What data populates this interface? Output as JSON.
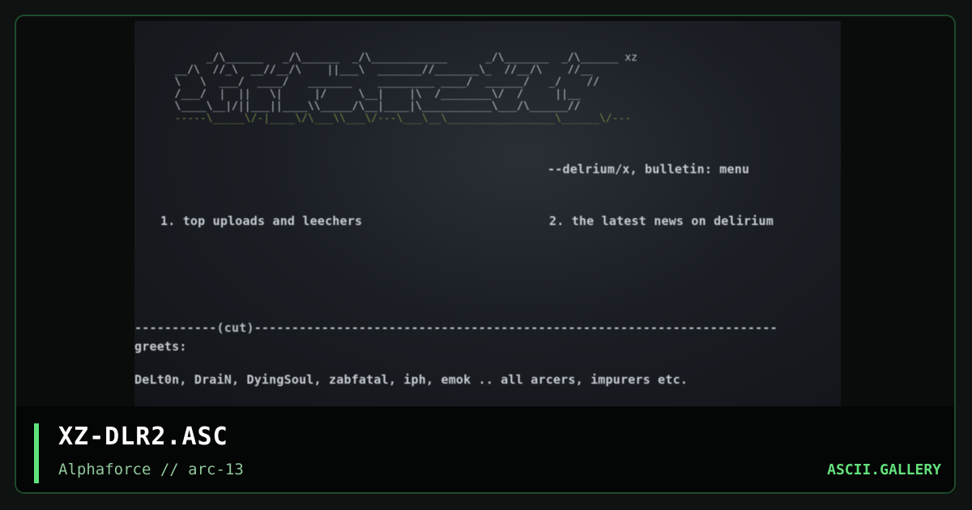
{
  "preview": {
    "ascii_logo": "       _/\\______   _/\\______  _/\\____________      _/\\_______  _/\\______ xz\n  __/\\  //_\\  __//__/\\    ||___\\  _______//_______\\_  //__/\\    //__\n  \\   \\  ___/  ____/   _______    _________ ____/  ______/   _/    //\n  /___/  |  ||   \\|     |/     \\__|    |\\  /________\\/  /     ||__\n  \\____\\__|/||___||____\\\\_____/\\__|____|\\___________\\___/\\______//\n",
    "ascii_dashes": "  -----\\_____\\/-|____\\/\\___\\\\___\\/---\\___\\__\\_________________\\______\\/---",
    "tagline": "--delrium/x, bulletin: menu",
    "menu_item_1": "1. top uploads and leechers",
    "menu_item_2": "2. the latest news on delirium",
    "divider": "-----------(cut)----------------------------------------------------------------------",
    "greets_label": "greets:",
    "greets_list": "DeLt0n, DraiN, DyingSoul, zabfatal, iph, emok .. all arcers, impurers etc."
  },
  "footer": {
    "title": "XZ-DLR2.ASC",
    "subtitle": "Alphaforce // arc-13",
    "brand": "ASCII.GALLERY"
  },
  "colors": {
    "accent": "#5fe37a",
    "brand": "#62e07b",
    "subtitle": "#8fc79a",
    "card_border": "#1f4a2b"
  }
}
